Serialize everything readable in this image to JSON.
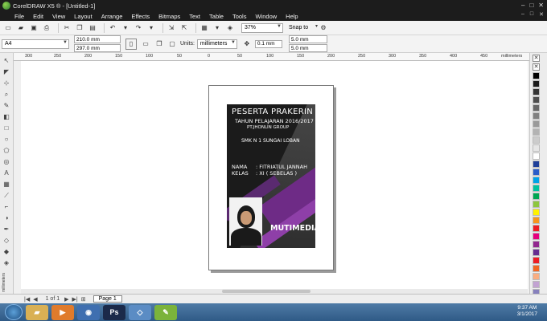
{
  "window": {
    "title": "CorelDRAW X5 ® - [Untitled-1]",
    "controls": [
      "–",
      "□",
      "✕"
    ]
  },
  "menu": {
    "items": [
      "File",
      "Edit",
      "View",
      "Layout",
      "Arrange",
      "Effects",
      "Bitmaps",
      "Text",
      "Table",
      "Tools",
      "Window",
      "Help"
    ],
    "doc_controls": [
      "–",
      "□",
      "✕"
    ]
  },
  "toolbar": {
    "zoom": "37%",
    "snap_to": "Snap to"
  },
  "propertybar": {
    "paper": "A4",
    "width": "210.0 mm",
    "height": "297.0 mm",
    "units_label": "Units:",
    "units": "millimeters",
    "nudge": "0.1 mm",
    "dup_x": "5.0 mm",
    "dup_y": "5.0 mm"
  },
  "ruler": {
    "ticks": [
      "300",
      "250",
      "200",
      "150",
      "100",
      "50",
      "0",
      "50",
      "100",
      "150",
      "200",
      "250",
      "300",
      "350",
      "400",
      "450"
    ],
    "unit": "millimeters",
    "vunit": "millimeters"
  },
  "card": {
    "title": "PESERTA PRAKERIN",
    "subtitle": "TAHUN PELAJARAN 2016/2017",
    "group": "PT.JHONLIN GROUP",
    "school": "SMK N 1 SUNGAI LOBAN",
    "name_label": "NAMA",
    "class_label": "KELAS",
    "name_value": ": FITRIATUL JANNAH",
    "class_value": ": XI ( SEBELAS )",
    "dept": "MUTIMEDIA"
  },
  "status": {
    "page_count": "1 of 1",
    "page_tab": "Page 1"
  },
  "taskbar": {
    "time": "9:37 AM",
    "date": "3/1/2017"
  },
  "palette": {
    "colors": [
      "#000000",
      "#1a1a1a",
      "#333333",
      "#4d4d4d",
      "#666666",
      "#808080",
      "#999999",
      "#b3b3b3",
      "#cccccc",
      "#e6e6e6",
      "#ffffff",
      "#1f3f99",
      "#2a5cc9",
      "#00a2e8",
      "#00c2a0",
      "#00a651",
      "#8dc63f",
      "#fff200",
      "#f7941d",
      "#ed1c24",
      "#e6007e",
      "#92278f",
      "#662d91",
      "#ed1c24",
      "#f26522",
      "#f9ad81",
      "#c2a3d2",
      "#8781bd",
      "#5c4b9b",
      "#a0a0d0",
      "#c0c0e0",
      "#6a7bb8",
      "#3c5aa0"
    ]
  }
}
